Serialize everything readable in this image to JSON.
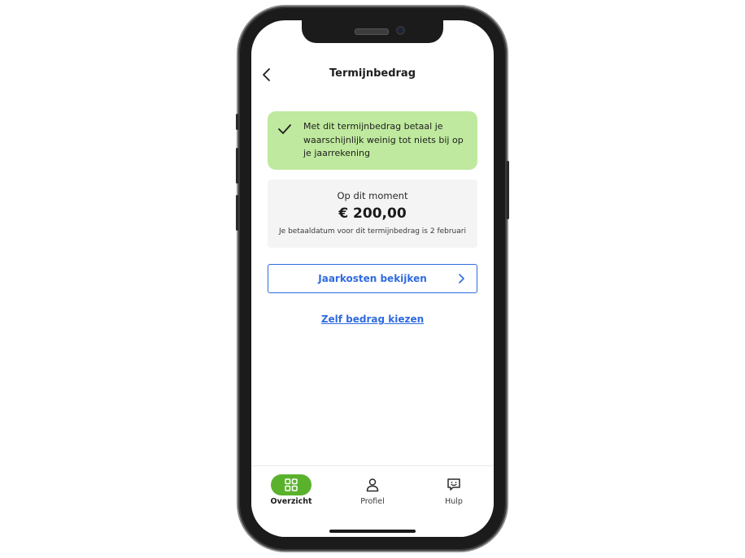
{
  "header": {
    "title": "Termijnbedrag"
  },
  "banner": {
    "message": "Met dit termijnbedrag betaal je waarschijnlijk weinig tot niets bij op je jaarrekening"
  },
  "amount": {
    "label": "Op dit moment",
    "value": "€ 200,00",
    "note": "Je betaaldatum voor dit termijnbedrag is 2 februari"
  },
  "actions": {
    "costs_button": "Jaarkosten bekijken",
    "choose_link": "Zelf bedrag kiezen"
  },
  "tabs": [
    {
      "label": "Overzicht",
      "icon": "grid-icon",
      "active": true
    },
    {
      "label": "Profiel",
      "icon": "person-icon",
      "active": false
    },
    {
      "label": "Hulp",
      "icon": "chat-icon",
      "active": false
    }
  ],
  "colors": {
    "accent": "#2f6be0",
    "success_bg": "#bfe99e",
    "tab_active": "#5ab22c"
  }
}
